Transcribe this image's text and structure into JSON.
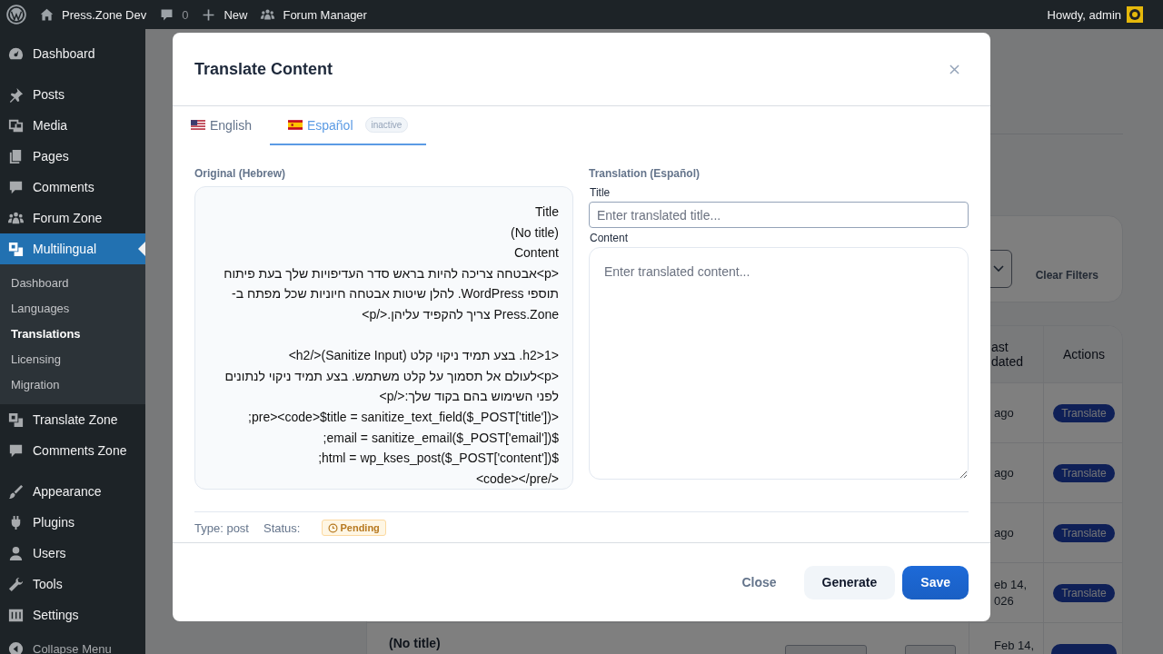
{
  "admin_bar": {
    "site": "Press.Zone Dev",
    "comments": "0",
    "new": "New",
    "forum": "Forum Manager",
    "greeting": "Howdy, admin"
  },
  "sidebar": {
    "groups": [
      {
        "items": [
          {
            "label": "Dashboard",
            "selected": false
          }
        ]
      },
      {
        "items": [
          {
            "label": "Posts",
            "selected": false
          },
          {
            "label": "Media",
            "selected": false
          },
          {
            "label": "Pages",
            "selected": false
          },
          {
            "label": "Comments",
            "selected": false
          },
          {
            "label": "Forum Zone",
            "selected": false
          },
          {
            "label": "Multilingual",
            "selected": true,
            "children": [
              {
                "label": "Dashboard",
                "selected": false
              },
              {
                "label": "Languages",
                "selected": false
              },
              {
                "label": "Translations",
                "selected": true
              },
              {
                "label": "Licensing",
                "selected": false
              },
              {
                "label": "Migration",
                "selected": false
              }
            ]
          },
          {
            "label": "Translate Zone",
            "selected": false
          },
          {
            "label": "Comments Zone",
            "selected": false
          }
        ]
      },
      {
        "items": [
          {
            "label": "Appearance",
            "selected": false
          },
          {
            "label": "Plugins",
            "selected": false
          },
          {
            "label": "Users",
            "selected": false
          },
          {
            "label": "Tools",
            "selected": false
          },
          {
            "label": "Settings",
            "selected": false
          }
        ]
      }
    ],
    "collapse": "Collapse Menu"
  },
  "background_page": {
    "filters": {
      "clear": "Clear Filters"
    },
    "table": {
      "columns": [
        {
          "label": "ast dated"
        },
        {
          "label": "Actions"
        }
      ],
      "rows": [
        {
          "last_updated": "ago",
          "action": "Translate"
        },
        {
          "last_updated": "ago",
          "action": "Translate"
        },
        {
          "last_updated": "ago",
          "action": "Translate"
        },
        {
          "last_updated": "eb 14, 026",
          "action": "Translate"
        },
        {
          "title": "(No title)",
          "last_updated": "Feb 14,"
        }
      ]
    }
  },
  "modal": {
    "title": "Translate Content",
    "tabs": [
      {
        "label": "English",
        "selected": false
      },
      {
        "label": "Español",
        "selected": true,
        "badge": "inactive"
      }
    ],
    "original": {
      "label": "Original (Hebrew)",
      "text": "Title\n(No title)\nContent\n<p>אבטחה צריכה להיות בראש סדר העדיפויות שלך בעת פיתוח תוספי WordPress. להלן שיטות אבטחה חיוניות שכל מפתח ב-Press.Zone צריך להקפיד עליהן.</p>\n\n<h2>1. בצע תמיד ניקוי קלט (Sanitize Input)</h2>\n<p>לעולם אל תסמוך על קלט משתמש. בצע תמיד ניקוי לנתונים לפני השימוש בהם בקוד שלך:</p>\n<pre><code>$title = sanitize_text_field($_POST['title']);\n$email = sanitize_email($_POST['email']);\n$html = wp_kses_post($_POST['content']);\n</code></pre>"
    },
    "translation": {
      "label": "Translation (Español)",
      "title_label": "Title",
      "title_placeholder": "Enter translated title...",
      "content_label": "Content",
      "content_placeholder": "Enter translated content..."
    },
    "meta": {
      "type": "Type: post",
      "status_label": "Status:",
      "status": "Pending"
    },
    "buttons": [
      {
        "label": "Close",
        "kind": "text"
      },
      {
        "label": "Generate",
        "kind": "secondary"
      },
      {
        "label": "Save",
        "kind": "primary"
      }
    ]
  }
}
